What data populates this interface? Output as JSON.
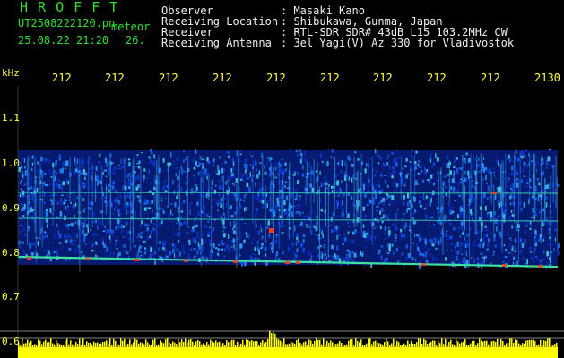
{
  "app_title": "H R O F F T",
  "file": {
    "name": "UT2508222120.pn",
    "type": "meteor",
    "datetime": "25.08.22 21:20",
    "count": "26."
  },
  "info": {
    "labels": [
      "Observer",
      "Receiving Location",
      "Receiver",
      "Receiving Antenna"
    ],
    "values": [
      ": Masaki Kano",
      ": Shibukawa, Gunma, Japan",
      ": RTL-SDR SDR# 43dB L15 103.2MHz CW",
      ": 3el Yagi(V) Az 330 for Vladivostok"
    ]
  },
  "axes": {
    "y_unit": "kHz",
    "y_ticks": [
      "1.1",
      "1.0",
      "0.9",
      "0.8",
      "0.7",
      "0.6"
    ],
    "x_ticks": [
      "212",
      "212",
      "212",
      "212",
      "212",
      "212",
      "212",
      "212",
      "212",
      "2130"
    ]
  },
  "colors": {
    "background": "#000000",
    "header_green": "#2fe02f",
    "axis_yellow": "#ffff40",
    "noise_blue": "#0a2ab4",
    "signal_green": "#3ce0a0",
    "hot_red": "#ff3a1a"
  }
}
